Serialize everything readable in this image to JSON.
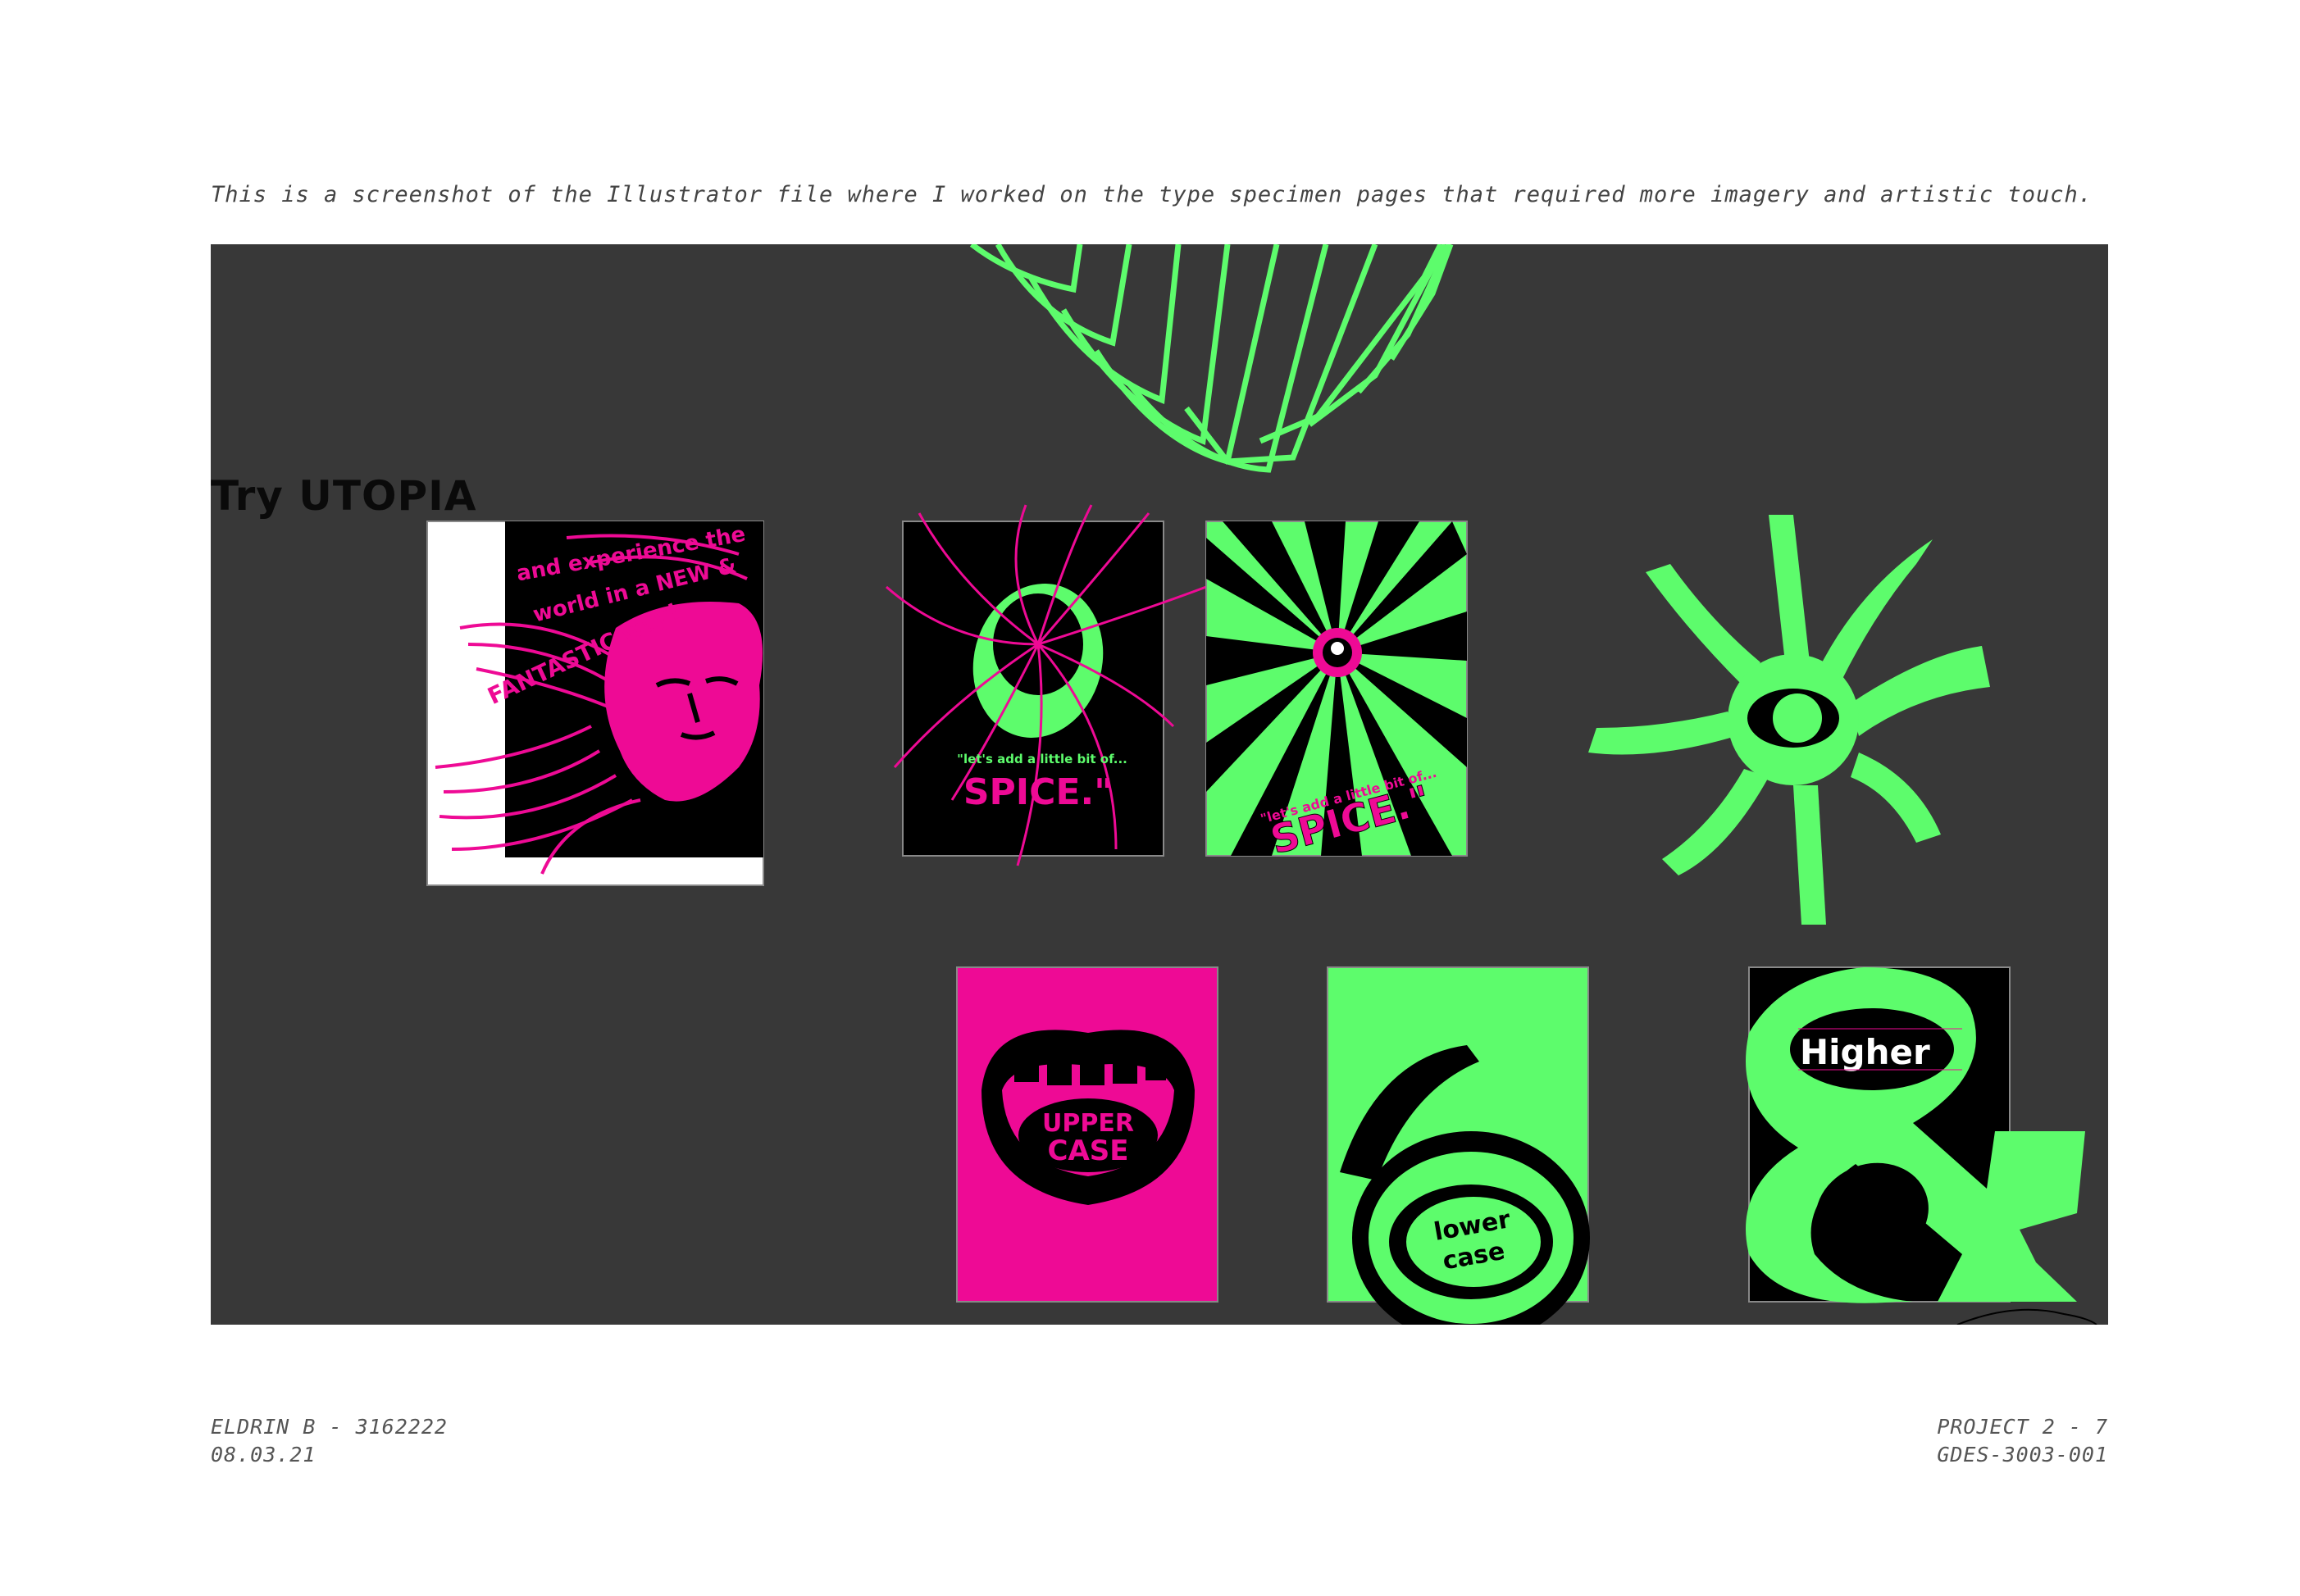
{
  "caption": "This is a screenshot of the Illustrator file where I worked on the type specimen pages that required more imagery and artistic touch.",
  "artboard": {
    "label": "Try UTOPIA",
    "posters": {
      "face": {
        "line1": "and experience the",
        "line2": "world in a NEW &",
        "line3": "FANTASTIC way!"
      },
      "eye_black": {
        "quote": "\"let's add a little bit of...",
        "word": "SPICE.\""
      },
      "eye_green": {
        "quote": "\"let's add a little bit of...",
        "word": "SPICE.\""
      },
      "mouth": {
        "line1": "UPPER",
        "line2": "CASE"
      },
      "lowercase_side": {
        "line1": "lower",
        "line2": "case"
      },
      "lowercase": {
        "line1": "lower",
        "line2": "case"
      },
      "higher": {
        "title": "Higher"
      }
    },
    "colors": {
      "background": "#383838",
      "neon_green": "#5dfc6c",
      "magenta": "#ee0a95",
      "black": "#000000"
    }
  },
  "footer": {
    "left": {
      "name_id": "ELDRIN B - 3162222",
      "date": "08.03.21"
    },
    "right": {
      "project": "PROJECT 2  -  7",
      "course": "GDES-3003-001"
    }
  }
}
